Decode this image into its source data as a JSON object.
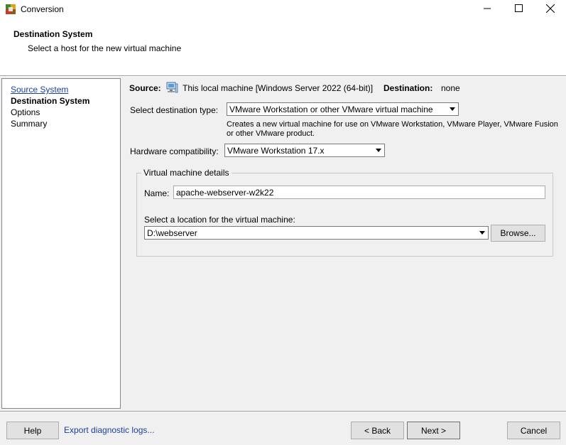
{
  "window": {
    "title": "Conversion",
    "icons": {
      "app": "converter-app-icon",
      "minimize": "minimize-icon",
      "maximize": "maximize-icon",
      "close": "close-icon"
    }
  },
  "header": {
    "title": "Destination System",
    "subtitle": "Select a host for the new virtual machine"
  },
  "nav": {
    "items": [
      {
        "label": "Source System",
        "state": "link"
      },
      {
        "label": "Destination System",
        "state": "current"
      },
      {
        "label": "Options",
        "state": "normal"
      },
      {
        "label": "Summary",
        "state": "normal"
      }
    ]
  },
  "source_line": {
    "source_label": "Source:",
    "source_icon": "computer-icon",
    "source_value": "This local machine [Windows Server 2022 (64-bit)]",
    "destination_label": "Destination:",
    "destination_value": "none"
  },
  "destination_type": {
    "label": "Select destination type:",
    "value": "VMware Workstation or other VMware virtual machine",
    "description": "Creates a new virtual machine for use on VMware Workstation, VMware Player, VMware Fusion or other VMware product."
  },
  "hardware": {
    "label": "Hardware compatibility:",
    "value": "VMware Workstation 17.x"
  },
  "vm_details": {
    "legend": "Virtual machine details",
    "name_label": "Name:",
    "name_value": "apache-webserver-w2k22",
    "location_label": "Select a location for the virtual machine:",
    "location_value": "D:\\webserver",
    "browse_label": "Browse..."
  },
  "footer": {
    "help_label": "Help",
    "export_label": "Export diagnostic logs...",
    "back_label": "< Back",
    "next_label": "Next >",
    "cancel_label": "Cancel"
  },
  "colors": {
    "link": "#1a3fa0",
    "background": "#f0f0f0"
  }
}
